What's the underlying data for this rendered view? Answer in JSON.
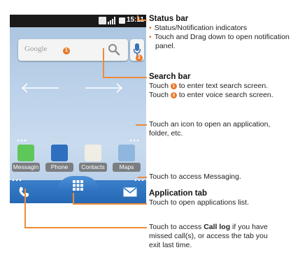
{
  "status_bar": {
    "time": "15:11"
  },
  "search": {
    "placeholder": "Google",
    "marker_1": "1",
    "marker_2": "2"
  },
  "apps": [
    {
      "label": "Messagin"
    },
    {
      "label": "Phone"
    },
    {
      "label": "Contacts"
    },
    {
      "label": "Maps"
    }
  ],
  "annotations": {
    "status_bar": {
      "title": "Status bar",
      "bullet_1": "Status/Notification indicators",
      "bullet_2_line1": "Touch and Drag down to open notification",
      "bullet_2_line2": "panel."
    },
    "search_bar": {
      "title": "Search bar",
      "line1_prefix": "Touch ",
      "line1_num": "1",
      "line1_suffix": " to enter text search screen.",
      "line2_prefix": "Touch ",
      "line2_num": "2",
      "line2_suffix": " to enter voice search screen."
    },
    "app_icon": {
      "line1": "Touch an icon to open an application,",
      "line2": "folder, etc."
    },
    "messaging": {
      "text": "Touch to access Messaging."
    },
    "app_tab": {
      "title": "Application tab",
      "text": "Touch to open applications list."
    },
    "call_log": {
      "line1_prefix": "Touch to access ",
      "line1_bold": "Call log",
      "line1_suffix": " if you have",
      "line2": "missed call(s), or access the tab you",
      "line3": "exit last time."
    }
  },
  "colors": {
    "callout": "#f08a36",
    "marker": "#e8792a",
    "dock": "#2f74c0"
  }
}
